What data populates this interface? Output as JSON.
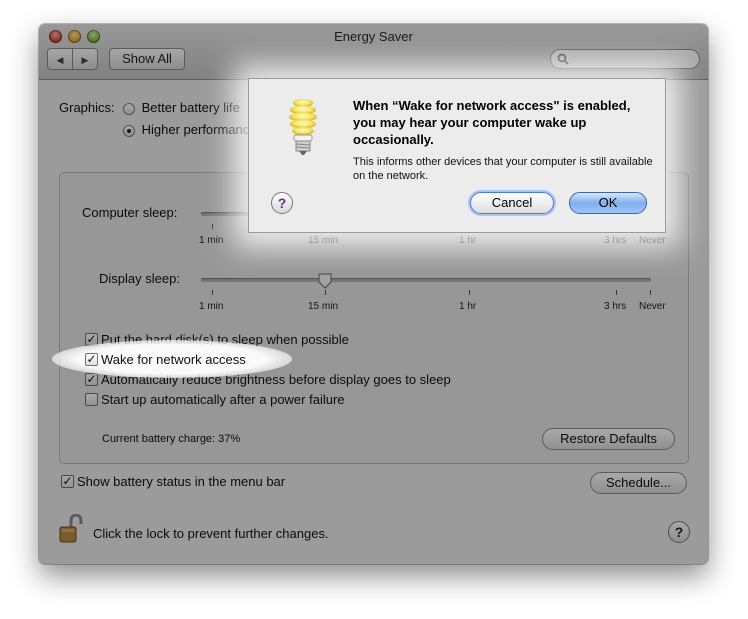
{
  "window": {
    "title": "Energy Saver"
  },
  "toolbar": {
    "back_icon": "◀",
    "forward_icon": "▶",
    "show_all": "Show All",
    "search_placeholder": ""
  },
  "graphics": {
    "label": "Graphics:",
    "options": [
      {
        "label": "Better battery life",
        "selected": false
      },
      {
        "label": "Higher performance",
        "selected": true
      }
    ]
  },
  "sliders": {
    "computer_sleep": {
      "label": "Computer sleep:"
    },
    "display_sleep": {
      "label": "Display sleep:",
      "value": "15 min"
    },
    "tick_labels": [
      "1 min",
      "15 min",
      "1 hr",
      "3 hrs",
      "Never"
    ]
  },
  "options": [
    {
      "label": "Put the hard disk(s) to sleep when possible",
      "checked": true
    },
    {
      "label": "Wake for network access",
      "checked": true
    },
    {
      "label": "Automatically reduce brightness before display goes to sleep",
      "checked": true
    },
    {
      "label": "Start up automatically after a power failure",
      "checked": false
    }
  ],
  "battery": {
    "charge": "Current battery charge: 37%"
  },
  "buttons": {
    "restore_defaults": "Restore Defaults",
    "schedule": "Schedule...",
    "help": "?"
  },
  "battery_menu": {
    "label": "Show battery status in the menu bar",
    "checked": true
  },
  "lock": {
    "text": "Click the lock to prevent further changes."
  },
  "dialog": {
    "title": "When “Wake for network access\" is enabled, you may hear your computer wake up occasionally.",
    "info": "This informs other devices that your computer is still available on the network.",
    "cancel": "Cancel",
    "ok": "OK",
    "help": "?"
  },
  "colors": {
    "default_button": "#7fb0ef",
    "window_bg": "#ececec"
  }
}
